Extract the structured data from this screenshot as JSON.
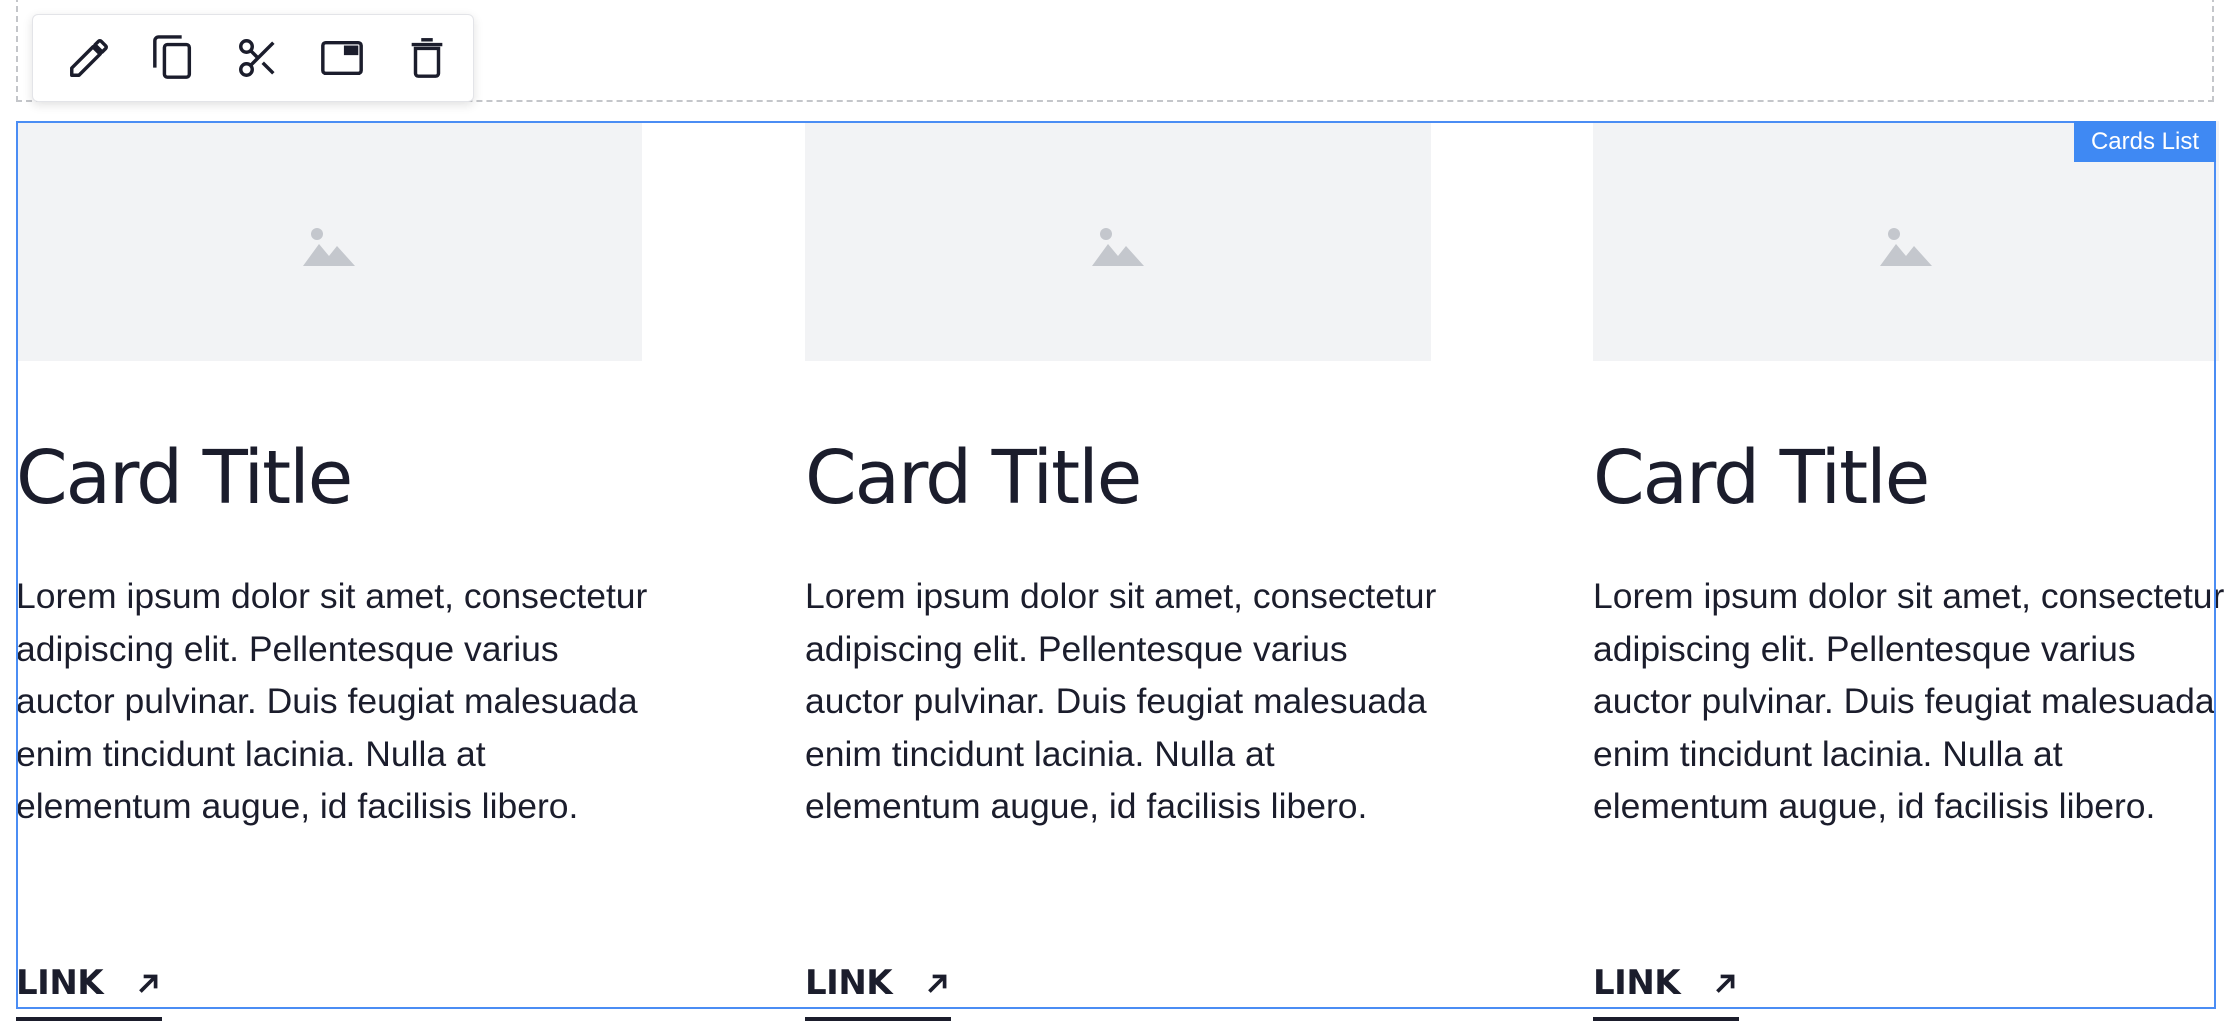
{
  "toolbar": {
    "items": [
      {
        "name": "edit",
        "icon": "pencil-icon"
      },
      {
        "name": "duplicate",
        "icon": "copy-icon"
      },
      {
        "name": "cut",
        "icon": "scissors-icon"
      },
      {
        "name": "move",
        "icon": "window-icon"
      },
      {
        "name": "delete",
        "icon": "trash-icon"
      }
    ]
  },
  "block": {
    "label": "Cards List",
    "accent_color": "#3f89f3"
  },
  "cards": [
    {
      "image_icon": "image-placeholder-icon",
      "title": "Card Title",
      "body": "Lorem ipsum dolor sit amet, consectetur adipiscing elit. Pellentesque varius auctor pulvinar. Duis feugiat malesuada enim tincidunt lacinia. Nulla at elementum augue, id facilisis libero.",
      "link_label": "LINK",
      "link_icon": "arrow-up-right-icon"
    },
    {
      "image_icon": "image-placeholder-icon",
      "title": "Card Title",
      "body": "Lorem ipsum dolor sit amet, consectetur adipiscing elit. Pellentesque varius auctor pulvinar. Duis feugiat malesuada enim tincidunt lacinia. Nulla at elementum augue, id facilisis libero.",
      "link_label": "LINK",
      "link_icon": "arrow-up-right-icon"
    },
    {
      "image_icon": "image-placeholder-icon",
      "title": "Card Title",
      "body": "Lorem ipsum dolor sit amet, consectetur adipiscing elit. Pellentesque varius auctor pulvinar. Duis feugiat malesuada enim tincidunt lacinia. Nulla at elementum augue, id facilisis libero.",
      "link_label": "LINK",
      "link_icon": "arrow-up-right-icon"
    }
  ]
}
